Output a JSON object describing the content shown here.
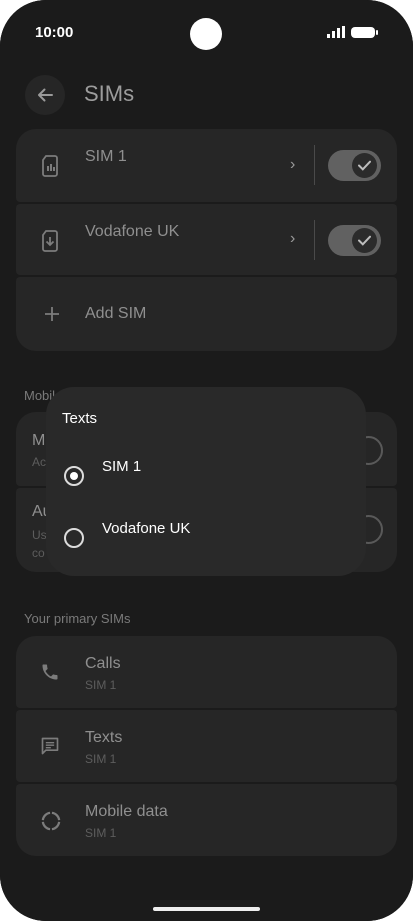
{
  "status_bar": {
    "time": "10:00"
  },
  "app_bar": {
    "title": "SIMs"
  },
  "sims": [
    {
      "name": "SIM 1",
      "enabled": true
    },
    {
      "name": "Vodafone UK",
      "enabled": true
    }
  ],
  "add_sim_label": "Add SIM",
  "mobile_section": {
    "label": "Mobile",
    "items": [
      {
        "title": "M",
        "subtitle": "Ac"
      },
      {
        "title": "Au",
        "subtitle_lines": [
          "Us",
          "co"
        ]
      }
    ]
  },
  "primary_section": {
    "label": "Your primary SIMs",
    "items": [
      {
        "title": "Calls",
        "value": "SIM 1",
        "icon": "phone-icon"
      },
      {
        "title": "Texts",
        "value": "SIM 1",
        "icon": "message-icon"
      },
      {
        "title": "Mobile data",
        "value": "SIM 1",
        "icon": "data-icon"
      }
    ]
  },
  "dialog": {
    "title": "Texts",
    "options": [
      {
        "label": "SIM 1",
        "selected": true
      },
      {
        "label": "Vodafone UK",
        "selected": false
      }
    ]
  },
  "colors": {
    "background": "#1b1b1b",
    "card": "#262626",
    "dialog": "#292929",
    "toggle_track": "#616161"
  }
}
